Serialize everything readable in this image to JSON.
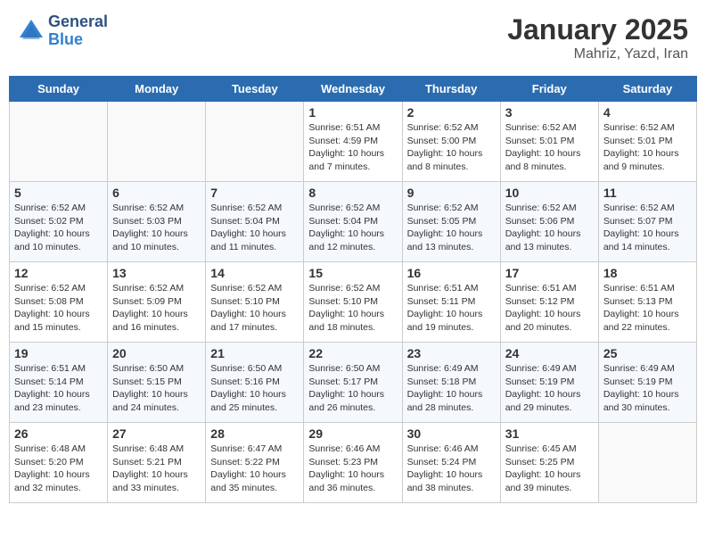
{
  "header": {
    "logo_line1": "General",
    "logo_line2": "Blue",
    "month_title": "January 2025",
    "location": "Mahriz, Yazd, Iran"
  },
  "weekdays": [
    "Sunday",
    "Monday",
    "Tuesday",
    "Wednesday",
    "Thursday",
    "Friday",
    "Saturday"
  ],
  "weeks": [
    [
      {
        "day": "",
        "info": ""
      },
      {
        "day": "",
        "info": ""
      },
      {
        "day": "",
        "info": ""
      },
      {
        "day": "1",
        "info": "Sunrise: 6:51 AM\nSunset: 4:59 PM\nDaylight: 10 hours\nand 7 minutes."
      },
      {
        "day": "2",
        "info": "Sunrise: 6:52 AM\nSunset: 5:00 PM\nDaylight: 10 hours\nand 8 minutes."
      },
      {
        "day": "3",
        "info": "Sunrise: 6:52 AM\nSunset: 5:01 PM\nDaylight: 10 hours\nand 8 minutes."
      },
      {
        "day": "4",
        "info": "Sunrise: 6:52 AM\nSunset: 5:01 PM\nDaylight: 10 hours\nand 9 minutes."
      }
    ],
    [
      {
        "day": "5",
        "info": "Sunrise: 6:52 AM\nSunset: 5:02 PM\nDaylight: 10 hours\nand 10 minutes."
      },
      {
        "day": "6",
        "info": "Sunrise: 6:52 AM\nSunset: 5:03 PM\nDaylight: 10 hours\nand 10 minutes."
      },
      {
        "day": "7",
        "info": "Sunrise: 6:52 AM\nSunset: 5:04 PM\nDaylight: 10 hours\nand 11 minutes."
      },
      {
        "day": "8",
        "info": "Sunrise: 6:52 AM\nSunset: 5:04 PM\nDaylight: 10 hours\nand 12 minutes."
      },
      {
        "day": "9",
        "info": "Sunrise: 6:52 AM\nSunset: 5:05 PM\nDaylight: 10 hours\nand 13 minutes."
      },
      {
        "day": "10",
        "info": "Sunrise: 6:52 AM\nSunset: 5:06 PM\nDaylight: 10 hours\nand 13 minutes."
      },
      {
        "day": "11",
        "info": "Sunrise: 6:52 AM\nSunset: 5:07 PM\nDaylight: 10 hours\nand 14 minutes."
      }
    ],
    [
      {
        "day": "12",
        "info": "Sunrise: 6:52 AM\nSunset: 5:08 PM\nDaylight: 10 hours\nand 15 minutes."
      },
      {
        "day": "13",
        "info": "Sunrise: 6:52 AM\nSunset: 5:09 PM\nDaylight: 10 hours\nand 16 minutes."
      },
      {
        "day": "14",
        "info": "Sunrise: 6:52 AM\nSunset: 5:10 PM\nDaylight: 10 hours\nand 17 minutes."
      },
      {
        "day": "15",
        "info": "Sunrise: 6:52 AM\nSunset: 5:10 PM\nDaylight: 10 hours\nand 18 minutes."
      },
      {
        "day": "16",
        "info": "Sunrise: 6:51 AM\nSunset: 5:11 PM\nDaylight: 10 hours\nand 19 minutes."
      },
      {
        "day": "17",
        "info": "Sunrise: 6:51 AM\nSunset: 5:12 PM\nDaylight: 10 hours\nand 20 minutes."
      },
      {
        "day": "18",
        "info": "Sunrise: 6:51 AM\nSunset: 5:13 PM\nDaylight: 10 hours\nand 22 minutes."
      }
    ],
    [
      {
        "day": "19",
        "info": "Sunrise: 6:51 AM\nSunset: 5:14 PM\nDaylight: 10 hours\nand 23 minutes."
      },
      {
        "day": "20",
        "info": "Sunrise: 6:50 AM\nSunset: 5:15 PM\nDaylight: 10 hours\nand 24 minutes."
      },
      {
        "day": "21",
        "info": "Sunrise: 6:50 AM\nSunset: 5:16 PM\nDaylight: 10 hours\nand 25 minutes."
      },
      {
        "day": "22",
        "info": "Sunrise: 6:50 AM\nSunset: 5:17 PM\nDaylight: 10 hours\nand 26 minutes."
      },
      {
        "day": "23",
        "info": "Sunrise: 6:49 AM\nSunset: 5:18 PM\nDaylight: 10 hours\nand 28 minutes."
      },
      {
        "day": "24",
        "info": "Sunrise: 6:49 AM\nSunset: 5:19 PM\nDaylight: 10 hours\nand 29 minutes."
      },
      {
        "day": "25",
        "info": "Sunrise: 6:49 AM\nSunset: 5:19 PM\nDaylight: 10 hours\nand 30 minutes."
      }
    ],
    [
      {
        "day": "26",
        "info": "Sunrise: 6:48 AM\nSunset: 5:20 PM\nDaylight: 10 hours\nand 32 minutes."
      },
      {
        "day": "27",
        "info": "Sunrise: 6:48 AM\nSunset: 5:21 PM\nDaylight: 10 hours\nand 33 minutes."
      },
      {
        "day": "28",
        "info": "Sunrise: 6:47 AM\nSunset: 5:22 PM\nDaylight: 10 hours\nand 35 minutes."
      },
      {
        "day": "29",
        "info": "Sunrise: 6:46 AM\nSunset: 5:23 PM\nDaylight: 10 hours\nand 36 minutes."
      },
      {
        "day": "30",
        "info": "Sunrise: 6:46 AM\nSunset: 5:24 PM\nDaylight: 10 hours\nand 38 minutes."
      },
      {
        "day": "31",
        "info": "Sunrise: 6:45 AM\nSunset: 5:25 PM\nDaylight: 10 hours\nand 39 minutes."
      },
      {
        "day": "",
        "info": ""
      }
    ]
  ]
}
